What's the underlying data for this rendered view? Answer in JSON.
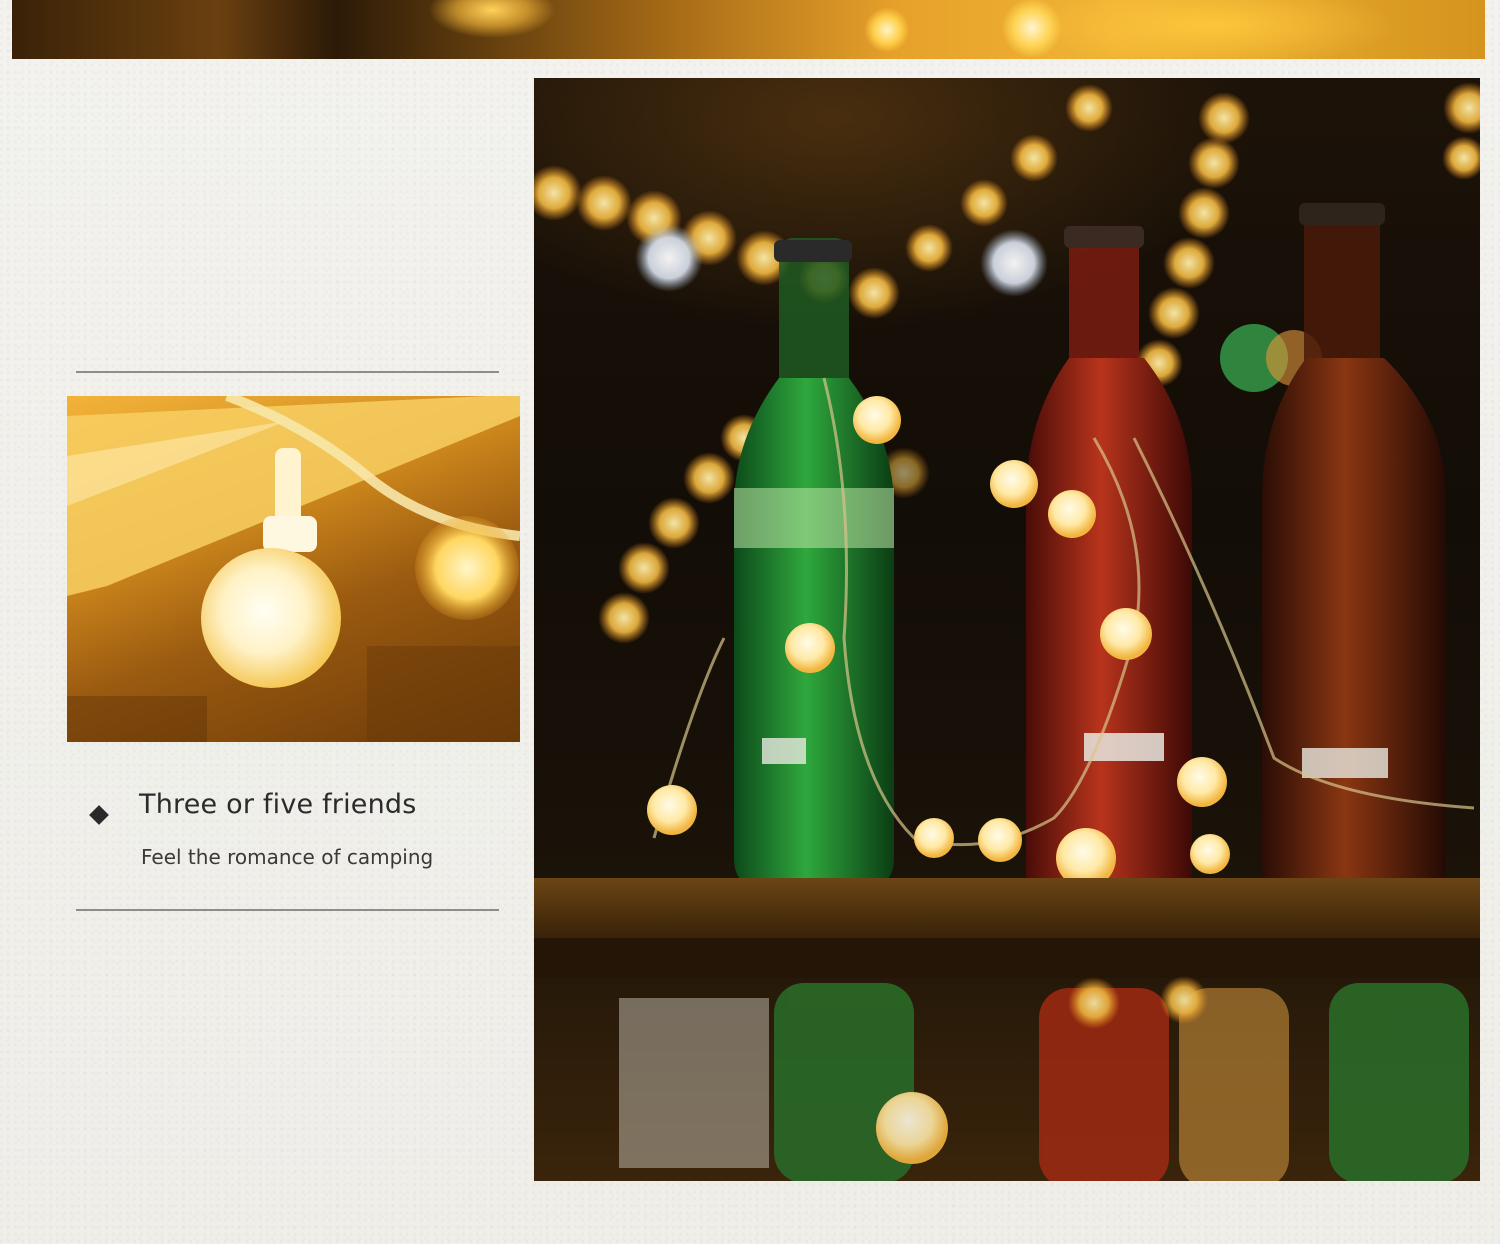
{
  "feature": {
    "heading": "Three or five friends",
    "subheading": "Feel the romance of camping"
  },
  "icons": {
    "bullet": "diamond-bullet-icon"
  },
  "colors": {
    "background": "#f2f1ed",
    "text_dark": "#2b2b2b",
    "rule": "#8e8d89",
    "warm_glow": "#ffd454"
  }
}
